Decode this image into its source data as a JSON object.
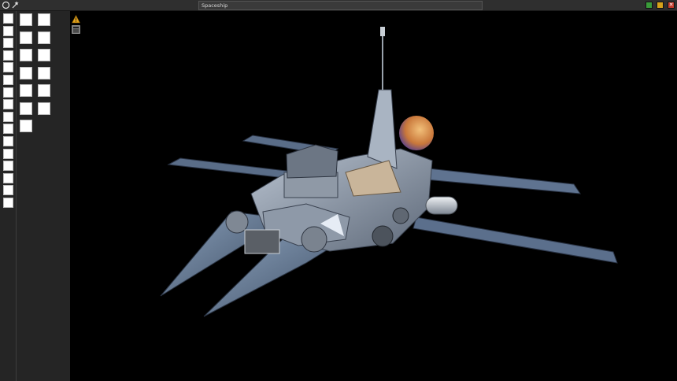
{
  "window": {
    "title": "Spaceship",
    "buttons": [
      {
        "name": "minimize",
        "color": "#3a9b3a"
      },
      {
        "name": "maximize",
        "color": "#d6a21b"
      },
      {
        "name": "close",
        "color": "#c23a2a",
        "glyph": "✕"
      }
    ]
  },
  "toolbar_icons": [
    "circle-select-icon",
    "wand-select-icon"
  ],
  "viewport_tools": [
    "warning-icon",
    "display-settings-icon"
  ],
  "palette": {
    "columns": [
      {
        "count": 16
      },
      {
        "count": 7
      },
      {
        "count": 6
      }
    ]
  },
  "scene": {
    "object": "spaceship-model",
    "background": "#000000"
  }
}
